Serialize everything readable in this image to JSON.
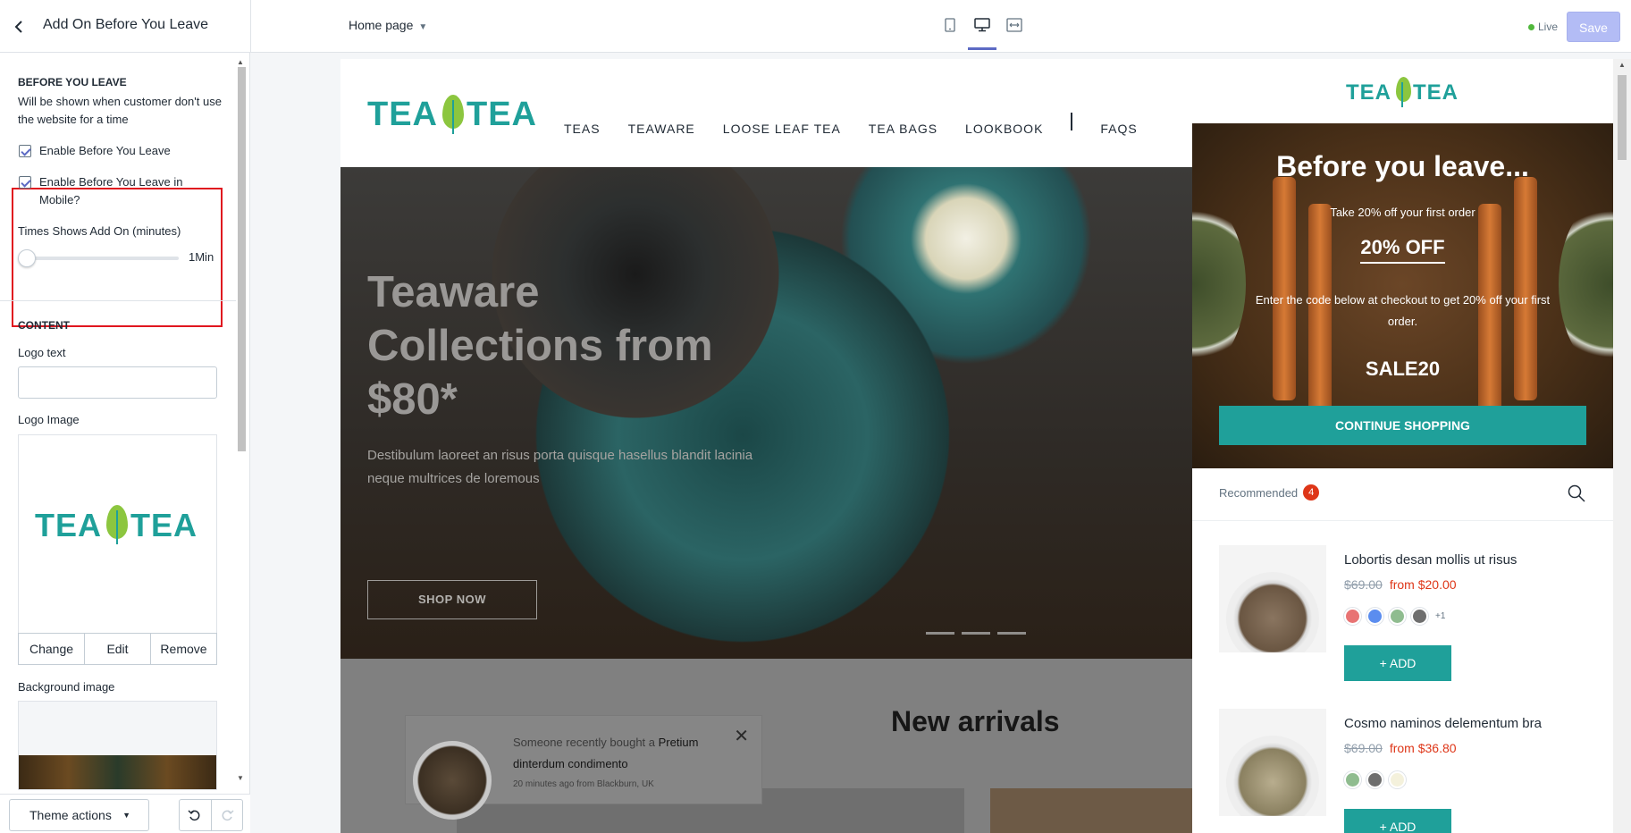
{
  "header": {
    "title": "Add On Before You Leave",
    "page_selector": "Home page",
    "live_label": "Live",
    "save_label": "Save"
  },
  "settings": {
    "section_title": "BEFORE YOU LEAVE",
    "section_desc": "Will be shown when customer don't use the website for a time",
    "enable_label": "Enable Before You Leave",
    "enable_checked": true,
    "enable_mobile_label": "Enable Before You Leave in Mobile?",
    "enable_mobile_checked": true,
    "times_label": "Times Shows Add On (minutes)",
    "times_value": "1Min",
    "content_title": "CONTENT",
    "logo_text_label": "Logo text",
    "logo_text_value": "",
    "logo_image_label": "Logo Image",
    "change_label": "Change",
    "edit_label": "Edit",
    "remove_label": "Remove",
    "background_label": "Background image"
  },
  "bottom": {
    "theme_actions": "Theme actions"
  },
  "store": {
    "logo_left": "TEA",
    "logo_right": "TEA",
    "menu": [
      "TEAS",
      "TEAWARE",
      "LOOSE LEAF TEA",
      "TEA BAGS",
      "LOOKBOOK",
      "FAQS"
    ],
    "hero_title": "Teaware Collections from $80*",
    "hero_sub": "Destibulum laoreet an risus porta quisque hasellus blandit lacinia neque multrices de loremous",
    "shop_now": "SHOP NOW",
    "new_arrivals": "New arrivals",
    "toast_text": "Someone recently bought a",
    "toast_product": "Pretium dinterdum condimento",
    "toast_meta": "20 minutes ago from Blackburn, UK"
  },
  "drawer": {
    "logo_left": "TEA",
    "logo_right": "TEA",
    "popup_title": "Before you leave...",
    "popup_sub": "Take 20% off your first order",
    "popup_off": "20% OFF",
    "popup_desc": "Enter the code below at checkout to get 20% off your first order.",
    "popup_code": "SALE20",
    "continue_label": "CONTINUE SHOPPING",
    "recommended_label": "Recommended",
    "recommended_count": "4",
    "products": [
      {
        "name": "Lobortis desan mollis ut risus",
        "old_price": "$69.00",
        "price": "from $20.00",
        "swatches": [
          "#e87373",
          "#5b8def",
          "#8fbc8f",
          "#6e6e6e"
        ],
        "more": "+1",
        "add": "ADD"
      },
      {
        "name": "Cosmo naminos delementum bra",
        "old_price": "$69.00",
        "price": "from $36.80",
        "swatches": [
          "#8fbc8f",
          "#6e6e6e",
          "#f4f1dc"
        ],
        "more": "",
        "add": "ADD"
      }
    ]
  }
}
